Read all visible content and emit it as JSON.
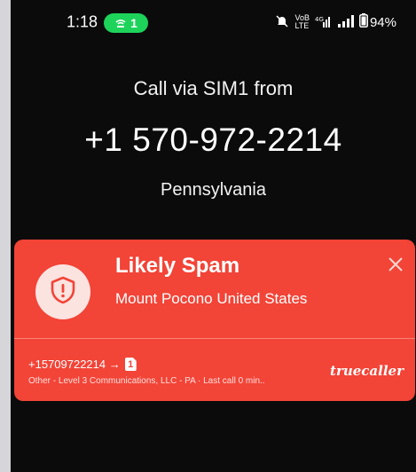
{
  "status_bar": {
    "time": "1:18",
    "hotspot_count": "1",
    "network_tiny": "VoB",
    "network_tiny2": "LTE",
    "lte_label": "⁴ᴳ",
    "battery": "94%"
  },
  "call": {
    "title": "Call via SIM1 from",
    "number": "+1 570-972-2214",
    "location": "Pennsylvania"
  },
  "spam_card": {
    "title": "Likely Spam",
    "location": "Mount Pocono United States",
    "detail_number": "+15709722214 →",
    "sim_badge": "1",
    "detail_info": "Other - Level 3 Communications, LLC - PA · Last call 0 min..",
    "brand": "truecaller",
    "color": "#f24437"
  }
}
